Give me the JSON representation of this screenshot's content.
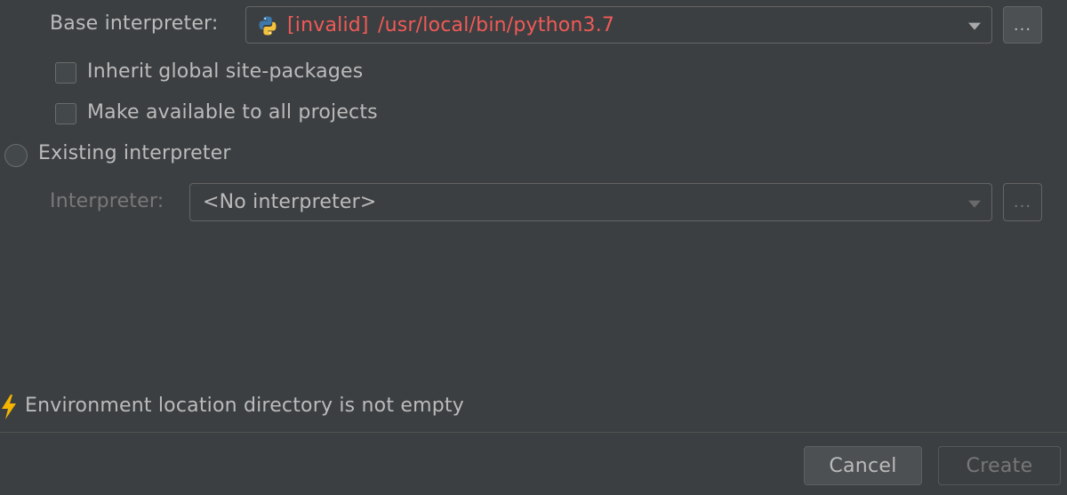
{
  "base_interpreter": {
    "label": "Base interpreter:",
    "prefix": "[invalid]",
    "path": "/usr/local/bin/python3.7",
    "browse_label": "...",
    "icon": "python-icon"
  },
  "options": {
    "inherit_label": "Inherit global site-packages",
    "inherit_checked": false,
    "make_available_label": "Make available to all projects",
    "make_available_checked": false
  },
  "existing": {
    "radio_label": "Existing interpreter",
    "selected": false,
    "interpreter_label": "Interpreter:",
    "interpreter_value": "<No interpreter>",
    "browse_label": "..."
  },
  "warning": {
    "icon": "lightning-icon",
    "text": "Environment location directory is not empty"
  },
  "footer": {
    "cancel_label": "Cancel",
    "create_label": "Create"
  },
  "colors": {
    "background": "#3c3f41",
    "error": "#f05a57",
    "warning": "#f4b400"
  }
}
